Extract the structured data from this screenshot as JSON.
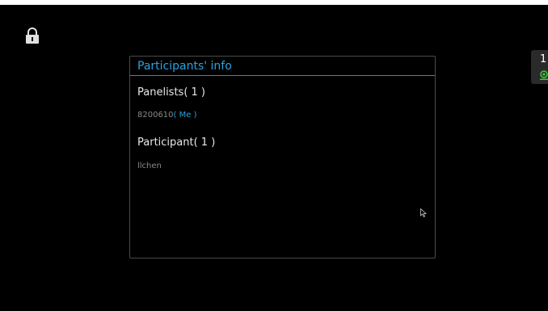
{
  "dialog": {
    "title": "Participants' info",
    "panelists": {
      "heading": "Panelists( 1 )",
      "entries": [
        {
          "id": "8200610",
          "tag": "( Me )"
        }
      ]
    },
    "participants": {
      "heading": "Participant( 1 )",
      "entries": [
        {
          "name": "llchen"
        }
      ]
    }
  },
  "side_panel": {
    "count": "1",
    "status_icon": "green-record-icon"
  },
  "icons": {
    "lock": "lock-icon",
    "cursor": "mouse-cursor-icon"
  },
  "colors": {
    "accent": "#2aa3e0",
    "status_green": "#3ad13a",
    "background": "#000000"
  }
}
